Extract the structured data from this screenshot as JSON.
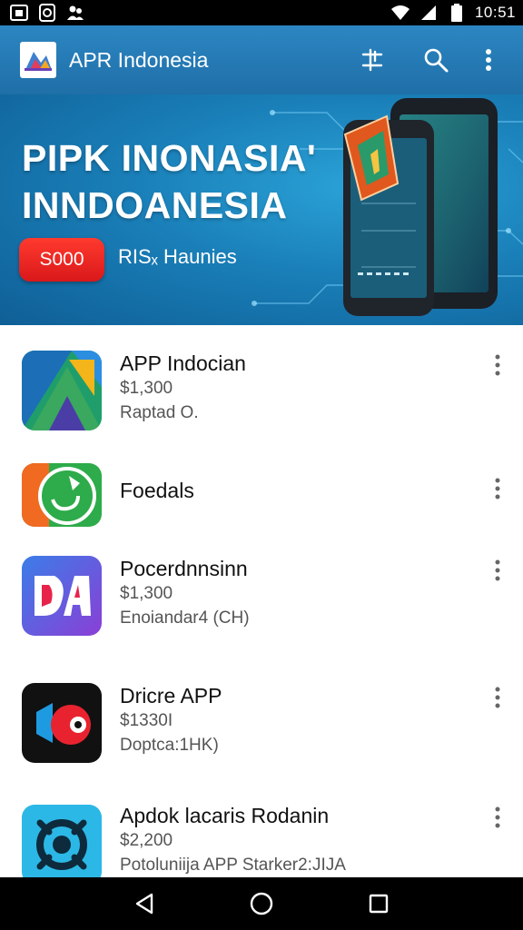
{
  "status_bar": {
    "time": "10:51"
  },
  "app_bar": {
    "title": "APR Indonesia"
  },
  "banner": {
    "title_line1": "PIPK INONASIA'",
    "title_line2": "INNDOANESIA",
    "button_label": "S000",
    "subtitle": "RISₓ Haunies"
  },
  "apps": [
    {
      "name": "APP Indocian",
      "price": "$1,300",
      "meta": "Raptad O."
    },
    {
      "name": "Foedals",
      "price": "",
      "meta": ""
    },
    {
      "name": "Pocerdnnsinn",
      "price": "$1,300",
      "meta": "Enoiandar4 (CH)"
    },
    {
      "name": "Dricre APP",
      "price": "$1330I",
      "meta": "Doptca:1HK)"
    },
    {
      "name": "Apdok lacaris Rodanin",
      "price": "$2,200",
      "meta": "Potoluniija APP Starker2:JIJA"
    }
  ],
  "colors": {
    "app_bar": "#2c86c2",
    "banner": "#1a7fb8",
    "accent_button": "#e8201c"
  }
}
